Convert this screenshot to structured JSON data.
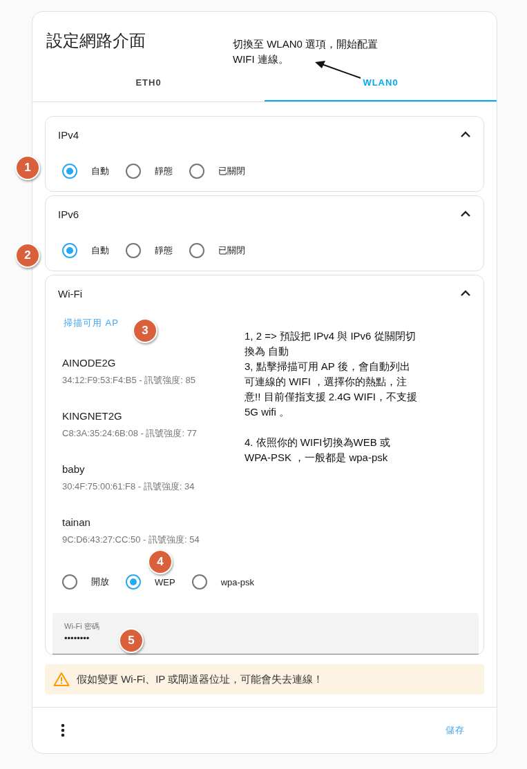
{
  "dialog": {
    "title": "設定網路介面",
    "tabs": [
      {
        "label": "ETH0",
        "selected": false
      },
      {
        "label": "WLAN0",
        "selected": true
      }
    ],
    "sections": [
      {
        "kind": "ip",
        "title": "IPv4",
        "expanded": true,
        "options": [
          {
            "label": "自動",
            "selected": true
          },
          {
            "label": "靜態",
            "selected": false
          },
          {
            "label": "已關閉",
            "selected": false
          }
        ]
      },
      {
        "kind": "ip",
        "title": "IPv6",
        "expanded": true,
        "options": [
          {
            "label": "自動",
            "selected": true
          },
          {
            "label": "靜態",
            "selected": false
          },
          {
            "label": "已關閉",
            "selected": false
          }
        ]
      },
      {
        "kind": "wifi",
        "title": "Wi-Fi",
        "expanded": true,
        "scan_button": "掃描可用 AP",
        "networks": [
          {
            "ssid": "AINODE2G",
            "detail": "34:12:F9:53:F4:B5 - 訊號強度: 85"
          },
          {
            "ssid": "KINGNET2G",
            "detail": "C8:3A:35:24:6B:08 - 訊號強度: 77"
          },
          {
            "ssid": "baby",
            "detail": "30:4F:75:00:61:F8 - 訊號強度: 34"
          },
          {
            "ssid": "tainan",
            "detail": "9C:D6:43:27:CC:50 - 訊號強度: 54"
          }
        ],
        "options": [
          {
            "label": "開放",
            "selected": false
          },
          {
            "label": "WEP",
            "selected": true
          },
          {
            "label": "wpa-psk",
            "selected": false
          }
        ],
        "password": {
          "label": "Wi-Fi 密碼",
          "value": "••••••••"
        }
      }
    ],
    "warning": "假如變更 Wi-Fi、IP 或閘道器位址，可能會失去連線！",
    "save_button": "儲存"
  },
  "annotations": {
    "notes": [
      [
        "切換至 WLAN0 選項，開始配置WIFI 連線。"
      ],
      [
        "1, 2 => 預設把 IPv4 與 IPv6 從關閉切換為 自動",
        "3, 點擊掃描可用 AP 後，會自動列出可連線的 WIFI ，選擇你的熱點，注意!! 目前僅指支援 2.4G WIFI，不支援 5G wifi 。",
        "4. 依照你的 WIFI切換為WEB 或 WPA-PSK ，一般都是 wpa-psk"
      ]
    ],
    "callouts": [
      "1",
      "2",
      "3",
      "4",
      "5"
    ]
  }
}
